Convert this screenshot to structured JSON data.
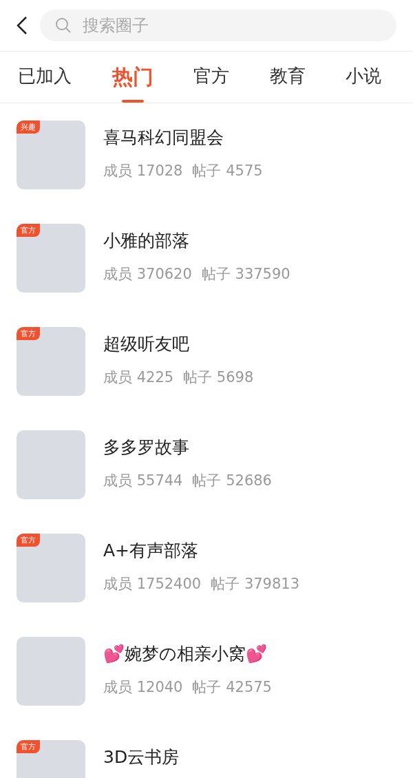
{
  "search": {
    "placeholder": "搜索圈子"
  },
  "tabs": [
    {
      "label": "已加入",
      "selected": false
    },
    {
      "label": "热门",
      "selected": true
    },
    {
      "label": "官方",
      "selected": false
    },
    {
      "label": "教育",
      "selected": false
    },
    {
      "label": "小说",
      "selected": false
    }
  ],
  "circles": [
    {
      "name": "喜马科幻同盟会",
      "badge": "兴趣",
      "members": "成员 17028",
      "posts": "帖子 4575"
    },
    {
      "name": "小雅的部落",
      "badge": "官方",
      "members": "成员 370620",
      "posts": "帖子 337590"
    },
    {
      "name": "超级听友吧",
      "badge": "官方",
      "members": "成员 4225",
      "posts": "帖子 5698"
    },
    {
      "name": "多多罗故事",
      "members": "成员 55744",
      "posts": "帖子 52686"
    },
    {
      "name": "A+有声部落",
      "badge": "官方",
      "members": "成员 1752400",
      "posts": "帖子 379813"
    },
    {
      "name": "💕婉梦の相亲小窝💕",
      "members": "成员 12040",
      "posts": "帖子 42575"
    },
    {
      "name": "3D云书房",
      "badge": "官方"
    }
  ]
}
